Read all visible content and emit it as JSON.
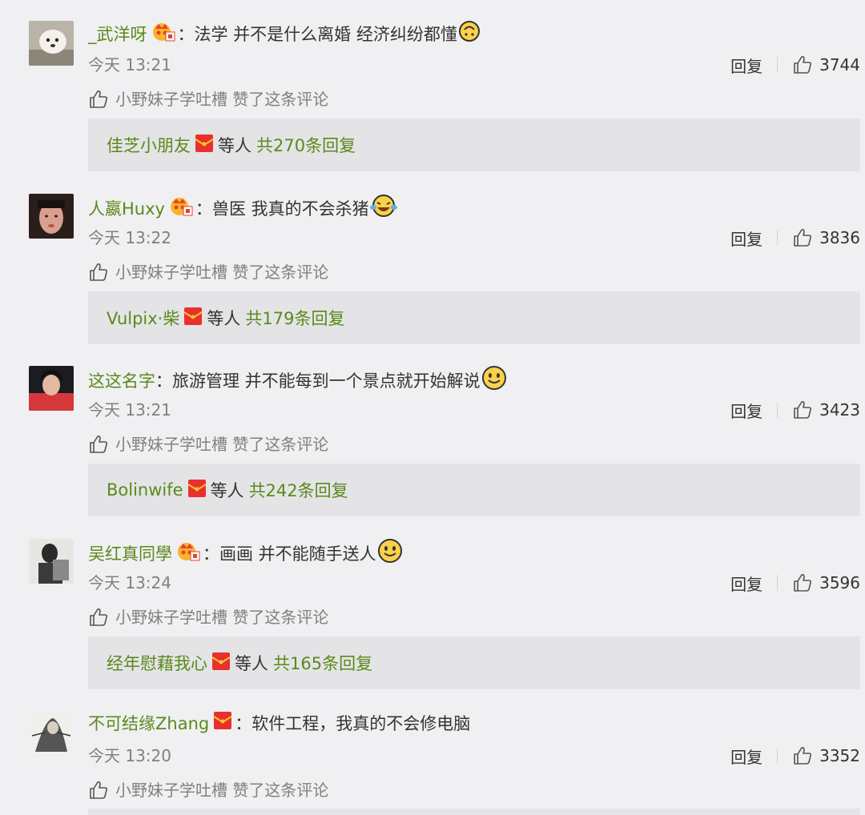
{
  "meta_label": "小野妹子学吐槽 赞了这条评论",
  "reply_label": "回复",
  "comments": [
    {
      "username": "_武洋呀",
      "colon": "：",
      "text": "法学 并不是什么离婚 经济纠纷都懂",
      "time": "今天 13:21",
      "likes": "3744",
      "reply_user": "佳芝小朋友",
      "reply_mid": "等人",
      "reply_count": "共270条回复",
      "badge": "vip-crown-icon",
      "emoji": "upside-down-face-icon"
    },
    {
      "username": "人嬴Huxy",
      "colon": "：",
      "text": "兽医  我真的不会杀猪",
      "time": "今天 13:22",
      "likes": "3836",
      "reply_user": "Vulpix·柴",
      "reply_mid": "等人",
      "reply_count": "共179条回复",
      "badge": "vip-crown-icon",
      "emoji": "crying-laughing-face-icon"
    },
    {
      "username": "这这名字",
      "colon": "：",
      "text": "旅游管理   并不能每到一个景点就开始解说",
      "time": "今天 13:21",
      "likes": "3423",
      "reply_user": "Bolinwife",
      "reply_mid": "等人",
      "reply_count": "共242条回复",
      "badge": "",
      "emoji": "smiling-face-icon"
    },
    {
      "username": "吴红真同學",
      "colon": "：",
      "text": "画画 并不能随手送人",
      "time": "今天 13:24",
      "likes": "3596",
      "reply_user": "经年慰藉我心",
      "reply_mid": "等人",
      "reply_count": "共165条回复",
      "badge": "vip-crown-icon",
      "emoji": "smiling-face-icon"
    },
    {
      "username": "不可结缘Zhang",
      "colon": "：",
      "text": "软件工程，我真的不会修电脑",
      "time": "今天 13:20",
      "likes": "3352",
      "badge": "red-envelope-icon",
      "emoji": ""
    }
  ],
  "colors": {
    "background": "#f0f0f2",
    "username": "#5a8a1a",
    "reply_box": "#e4e4e7",
    "meta": "#808080"
  }
}
